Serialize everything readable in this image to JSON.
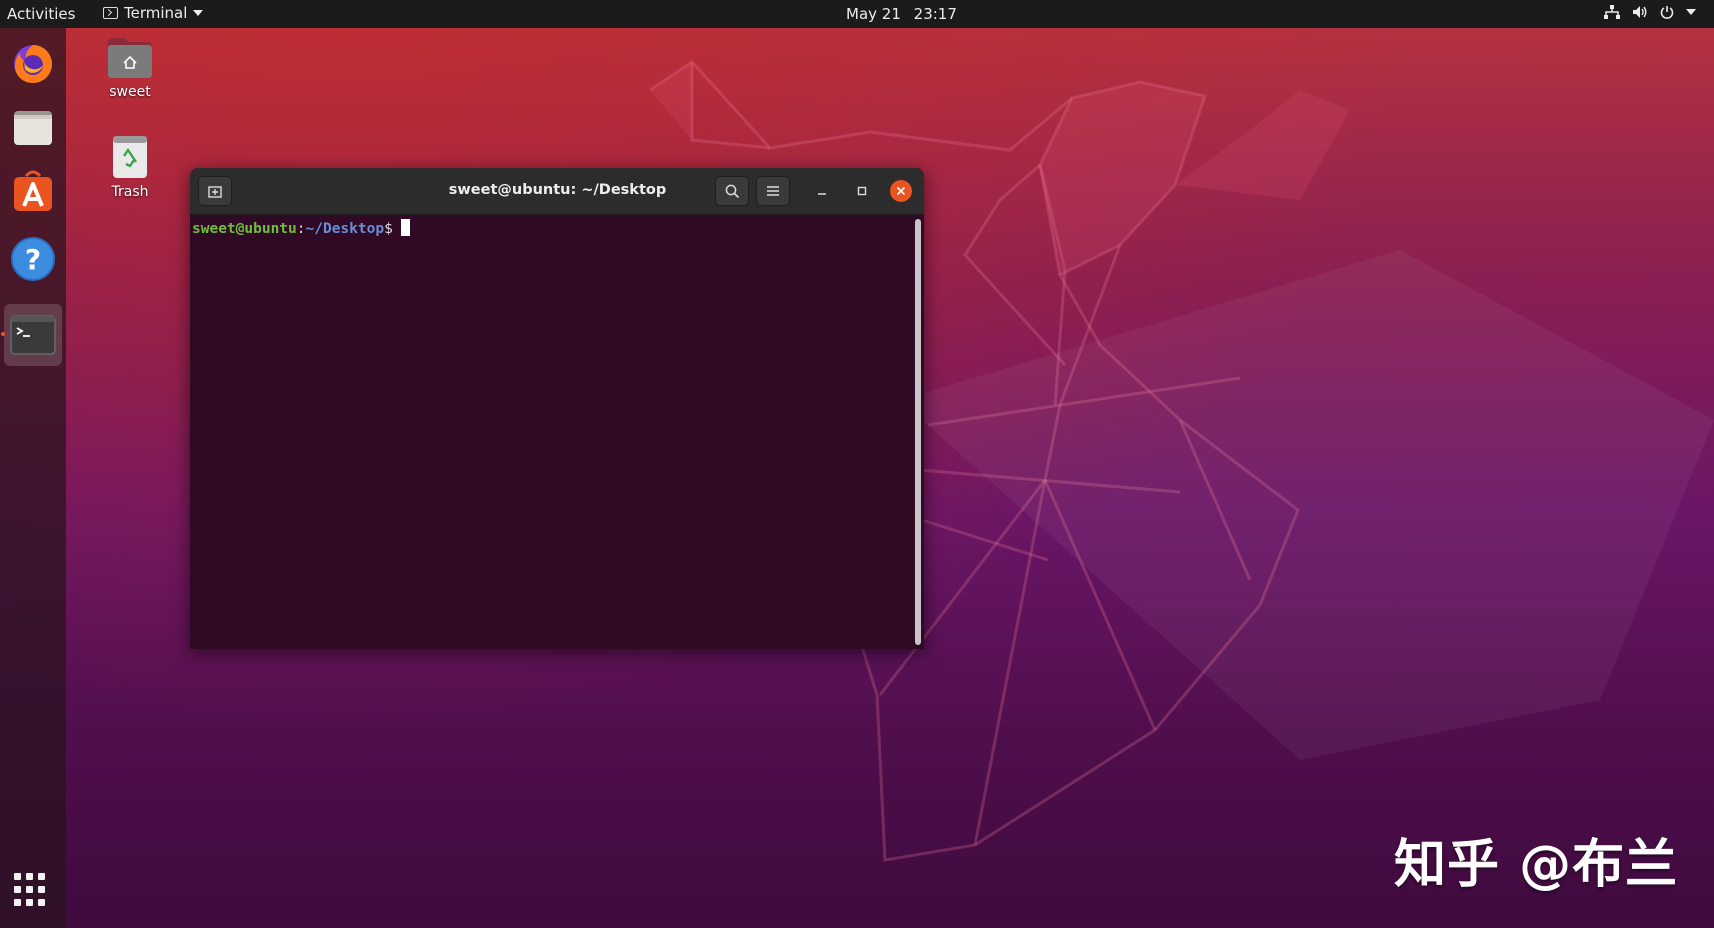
{
  "topbar": {
    "activities": "Activities",
    "app_menu": "Terminal",
    "date": "May 21",
    "time": "23:17"
  },
  "dock": {
    "items": [
      {
        "name": "firefox",
        "icon": "firefox-icon"
      },
      {
        "name": "files",
        "icon": "files-icon"
      },
      {
        "name": "software",
        "icon": "ubuntu-software-icon"
      },
      {
        "name": "help",
        "icon": "help-icon"
      },
      {
        "name": "terminal",
        "icon": "terminal-icon",
        "running": true
      }
    ],
    "show_apps_icon": "grid-icon"
  },
  "desktop": {
    "icons": [
      {
        "label": "sweet",
        "icon": "home-folder-icon"
      },
      {
        "label": "Trash",
        "icon": "trash-icon"
      }
    ]
  },
  "terminal": {
    "title": "sweet@ubuntu: ~/Desktop",
    "prompt_user": "sweet@ubuntu",
    "prompt_sep": ":",
    "prompt_path": "~/Desktop",
    "prompt_dollar": "$"
  },
  "watermark": "知乎 @布兰",
  "colors": {
    "accent": "#e95420",
    "terminal_bg": "#300a24",
    "prompt_user": "#6ebf3a",
    "prompt_path": "#6a8fd6"
  }
}
